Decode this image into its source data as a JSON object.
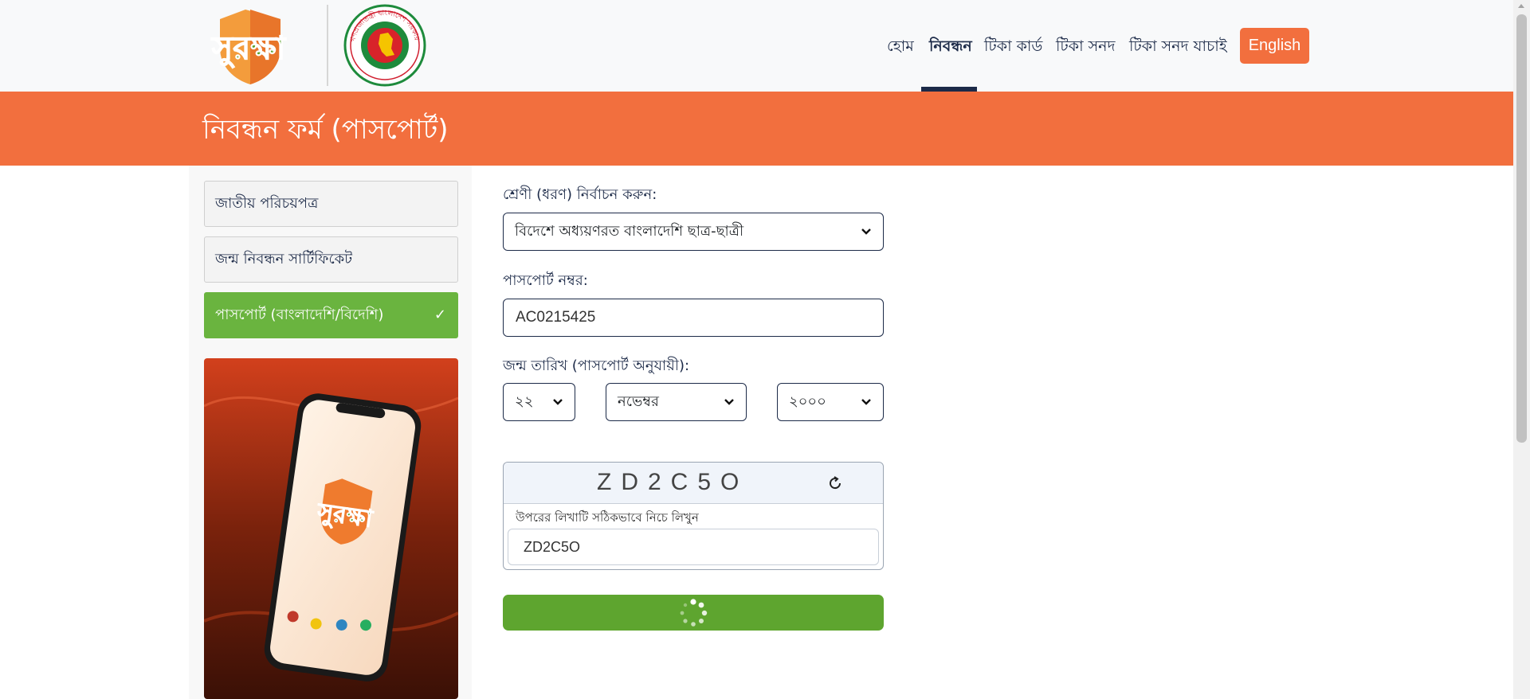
{
  "header": {
    "brand_logo_text": "সুরক্ষা",
    "govt_logo_text": "গণপ্রজাতন্ত্রী বাংলাদেশ সরকার",
    "nav": [
      {
        "label": "হোম",
        "active": false
      },
      {
        "label": "নিবন্ধন",
        "active": true
      },
      {
        "label": "টিকা কার্ড",
        "active": false
      },
      {
        "label": "টিকা সনদ",
        "active": false
      },
      {
        "label": "টিকা সনদ যাচাই",
        "active": false
      }
    ],
    "language_button": "English"
  },
  "banner": {
    "title": "নিবন্ধন ফর্ম (পাসপোর্ট)"
  },
  "sidebar": {
    "documents": [
      {
        "label": "জাতীয় পরিচয়পত্র",
        "selected": false
      },
      {
        "label": "জন্ম নিবন্ধন সার্টিফিকেট",
        "selected": false
      },
      {
        "label": "পাসপোর্ট (বাংলাদেশি/বিদেশি)",
        "selected": true
      }
    ],
    "check_icon": "✓"
  },
  "form": {
    "category_label": "শ্রেণী (ধরণ) নির্বাচন করুন:",
    "category_value": "বিদেশে অধ্যয়ণরত বাংলাদেশি ছাত্র-ছাত্রী",
    "passport_label": "পাসপোর্ট নম্বর:",
    "passport_value": "AC0215425",
    "dob_label": "জন্ম তারিখ (পাসপোর্ট অনুযায়ী):",
    "dob_day": "২২",
    "dob_month": "নভেম্বর",
    "dob_year": "২০০০",
    "captcha_text": "ZD2C5O",
    "captcha_hint": "উপরের লিখাটি সঠিকভাবে নিচে লিখুন",
    "captcha_input_value": "ZD2C5O"
  },
  "colors": {
    "accent_orange": "#f26f3e",
    "accent_green": "#6ab43f",
    "submit_green": "#5ea52f",
    "navy": "#1c2a48"
  }
}
